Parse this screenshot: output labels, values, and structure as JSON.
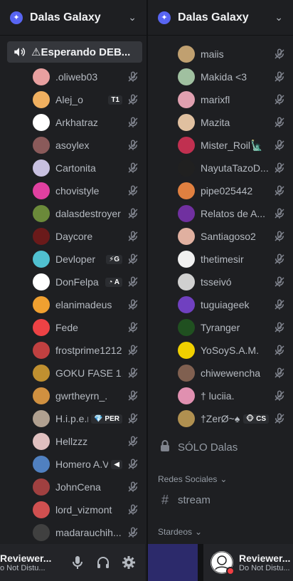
{
  "left_panel": {
    "server_name": "Dalas Galaxy",
    "voice_channel": "⚠Esperando DEB...",
    "members": [
      {
        "name": ".oliweb03",
        "color": "#e8a0a0"
      },
      {
        "name": "Alej_o",
        "tag": "T1",
        "color": "#f0b060"
      },
      {
        "name": "Arkhatraz",
        "color": "#ffffff"
      },
      {
        "name": "asoylex",
        "color": "#8a5a5a"
      },
      {
        "name": "Cartonita",
        "color": "#c8c0e0"
      },
      {
        "name": "chovistyle",
        "color": "#e040a0"
      },
      {
        "name": "dalasdestroyer",
        "color": "#6b8a3a"
      },
      {
        "name": "Daycore",
        "color": "#6a1a1a"
      },
      {
        "name": "Devloper",
        "tag": "⚡G",
        "color": "#50c0d0"
      },
      {
        "name": "DonFelpa",
        "tag": "◔ A",
        "color": "#ffffff"
      },
      {
        "name": "elanimadeus",
        "color": "#f0a030"
      },
      {
        "name": "Fede",
        "color": "#ed4245"
      },
      {
        "name": "frostprime1212",
        "color": "#c04040"
      },
      {
        "name": "GOKU FASE 1...",
        "color": "#c09030"
      },
      {
        "name": "gwrtheyrn_.",
        "color": "#d09040"
      },
      {
        "name": "H.i.p.e.r",
        "tag": "💎 PER",
        "color": "#b0a090"
      },
      {
        "name": "Hellzzz",
        "color": "#e0c0c0"
      },
      {
        "name": "Homero A.V.",
        "tag": "◀",
        "color": "#5080c0"
      },
      {
        "name": "JohnCena",
        "color": "#a04040"
      },
      {
        "name": "lord_vizmont",
        "color": "#d05050"
      },
      {
        "name": "madarauchih...",
        "color": "#404040"
      }
    ]
  },
  "right_panel": {
    "server_name": "Dalas Galaxy",
    "members": [
      {
        "name": "maiis",
        "color": "#c0a070"
      },
      {
        "name": "Makida <3",
        "color": "#a0c0a0"
      },
      {
        "name": "marixfl",
        "color": "#e0a0b0"
      },
      {
        "name": "Mazita",
        "color": "#e0c0a0"
      },
      {
        "name": "Mister_Roil🗽",
        "color": "#c03050"
      },
      {
        "name": "NayutaTazoD...",
        "color": "#202020"
      },
      {
        "name": "pipe025442",
        "color": "#e08040"
      },
      {
        "name": "Relatos de A...",
        "color": "#7030a0"
      },
      {
        "name": "Santiagoso2",
        "color": "#e0b0a0"
      },
      {
        "name": "thetimesir",
        "color": "#f0f0f0"
      },
      {
        "name": "tsseivó",
        "color": "#d0d0d0"
      },
      {
        "name": "tuguiageek",
        "color": "#7040c0"
      },
      {
        "name": "Tyranger",
        "color": "#205020"
      },
      {
        "name": "YoSoyS.A.M.",
        "color": "#f0d000"
      },
      {
        "name": "chiwewencha",
        "color": "#806050"
      },
      {
        "name": "† luciia.",
        "color": "#e090b0"
      },
      {
        "name": "†ZerØ~♠",
        "tag": "🐵 CS",
        "color": "#b09050"
      }
    ],
    "locked_channel": "SÓLO Dalas",
    "category_redes": "Redes Sociales",
    "text_channel": "stream",
    "category_stardeos": "Stardeos"
  },
  "user_bar": {
    "left_name": "Reviewer...",
    "left_status": "o Not Distu...",
    "right_name": "Reviewer...",
    "right_status": "Do Not Distu..."
  },
  "colors": {
    "accent": "#5865f2",
    "dnd": "#f23f43",
    "muted_icon": "#80848e"
  }
}
